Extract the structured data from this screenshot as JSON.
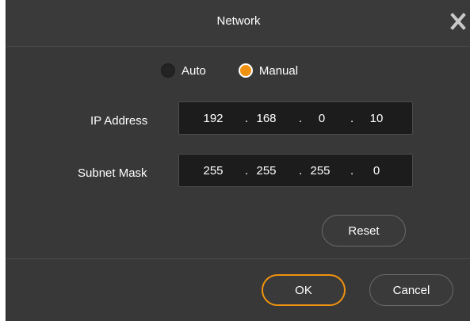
{
  "dialog": {
    "title": "Network",
    "close_icon": "close-icon"
  },
  "mode": {
    "options": [
      {
        "label": "Auto",
        "selected": false
      },
      {
        "label": "Manual",
        "selected": true
      }
    ]
  },
  "ip_address": {
    "label": "IP Address",
    "octets": [
      "192",
      "168",
      "0",
      "10"
    ]
  },
  "subnet_mask": {
    "label": "Subnet Mask",
    "octets": [
      "255",
      "255",
      "255",
      "0"
    ]
  },
  "buttons": {
    "reset": "Reset",
    "ok": "OK",
    "cancel": "Cancel"
  },
  "colors": {
    "accent": "#f0920f",
    "background": "#383838",
    "field_background": "#1c1c1c"
  }
}
